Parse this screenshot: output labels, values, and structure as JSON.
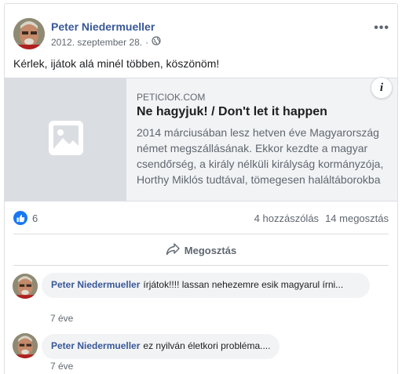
{
  "post": {
    "author": "Peter Niedermueller",
    "date": "2012. szeptember 28.",
    "audience_icon": "globe-icon",
    "more_label": "•••",
    "text": "Kérlek, ijátok alá minél többen, köszönöm!"
  },
  "link_preview": {
    "domain": "PETICIOK.COM",
    "title": "Ne hagyjuk! / Don't let it happen",
    "description": "2014 márciusában lesz hetven éve Magyarország német megszállásának. Ekkor kezdte a magyar csendőrség, a király nélküli királyság kormányzója, Horthy Miklós tudtával, tömegesen haláltáborokba",
    "info_label": "i",
    "thumbnail_icon": "image-placeholder-icon"
  },
  "reactions": {
    "like_count": "6",
    "comments": "4 hozzászólás",
    "shares": "14 megosztás"
  },
  "actions": {
    "share_label": "Megosztás"
  },
  "comments": [
    {
      "author": "Peter Niedermueller",
      "text": "írjátok!!!! lassan nehezemre esik magyarul írni...",
      "time": "7 éve"
    },
    {
      "author": "Peter Niedermueller",
      "text": "ez nyilván életkori probléma....",
      "time": "7 éve"
    }
  ],
  "colors": {
    "link_blue": "#385898",
    "like_blue": "#1877f2",
    "muted": "#606770",
    "bubble_bg": "#f2f3f5"
  }
}
